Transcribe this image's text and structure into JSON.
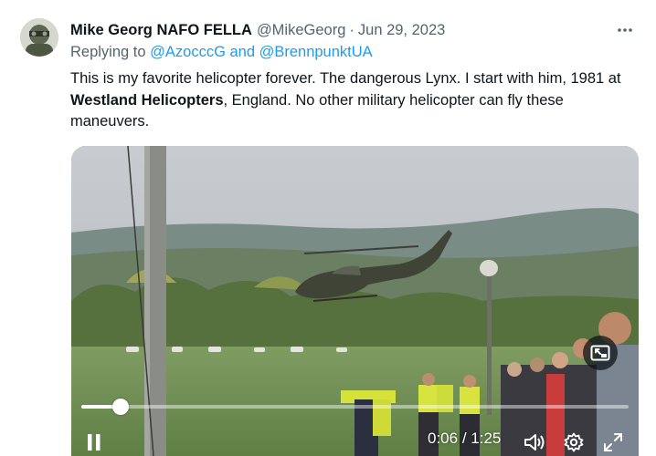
{
  "tweet": {
    "author_name": "Mike Georg NAFO FELLA",
    "handle": "@MikeGeorg",
    "separator": "·",
    "date": "Jun 29, 2023",
    "more_label": "···",
    "reply_prefix": "Replying to ",
    "reply_mentions": "@AzocccG and @BrennpunktUA",
    "text_part1": "This is my favorite helicopter forever. The dangerous Lynx. I start with him, 1981 at ",
    "text_bold": "Westland Helicopters",
    "text_part2": ", England. No other military helicopter can fly these maneuvers."
  },
  "video": {
    "current_time": "0:06",
    "time_separator": " / ",
    "duration": "1:25",
    "progress_fraction": 0.071,
    "pause_icon": "pause-icon",
    "volume_icon": "volume-icon",
    "settings_icon": "settings-gear-icon",
    "fullscreen_icon": "fullscreen-expand-icon",
    "pip_icon": "picture-in-picture-icon"
  },
  "colors": {
    "link": "#1d9bf0",
    "secondary_text": "#536471",
    "primary_text": "#0f1419"
  }
}
